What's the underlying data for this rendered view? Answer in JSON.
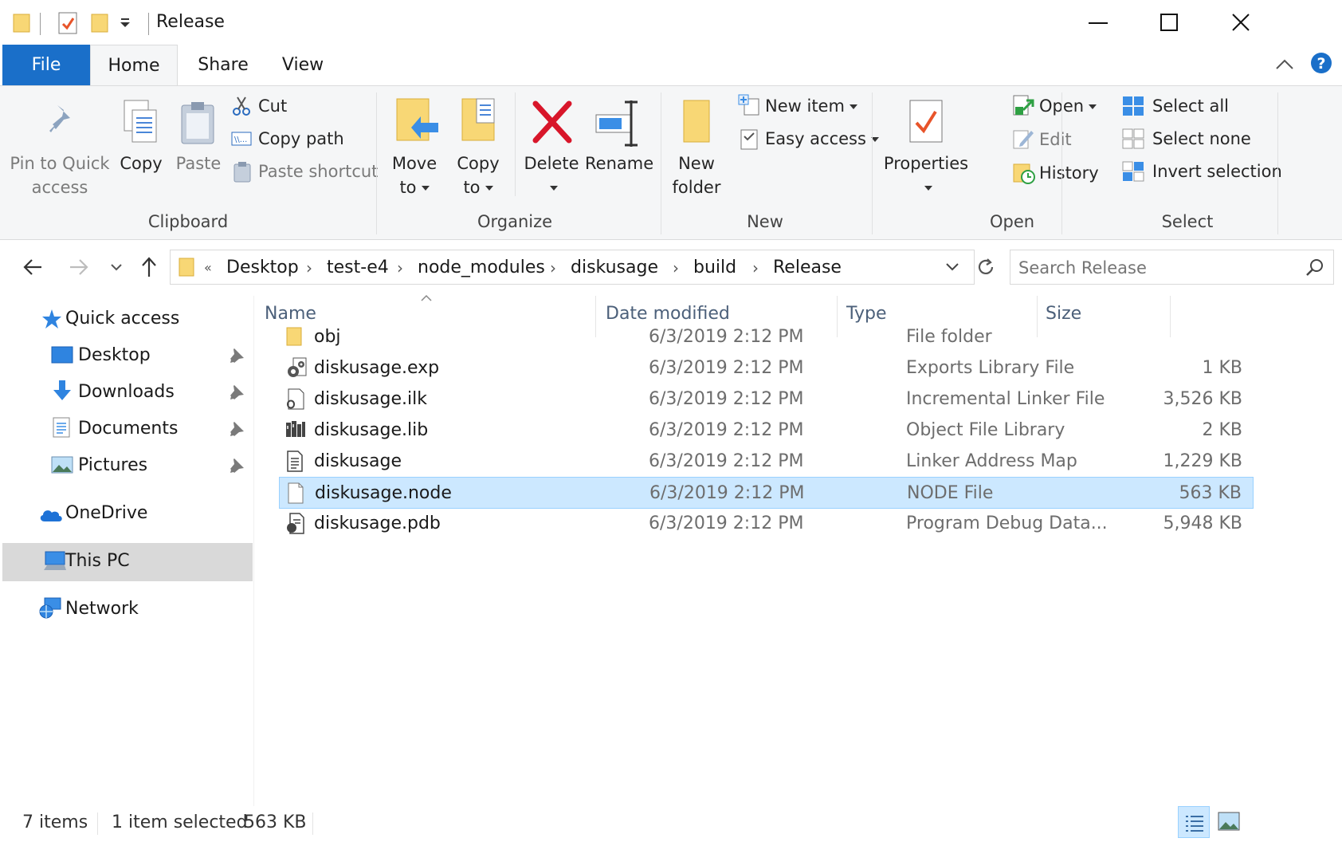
{
  "window": {
    "title": "Release",
    "controls": {
      "minimize": "minimize-icon",
      "maximize": "maximize-icon",
      "close": "close-icon"
    }
  },
  "ribbon_tabs": [
    {
      "label": "File",
      "active": false
    },
    {
      "label": "Home",
      "active": true
    },
    {
      "label": "Share",
      "active": false
    },
    {
      "label": "View",
      "active": false
    }
  ],
  "ribbon": {
    "clipboard": {
      "label": "Clipboard",
      "pin_line1": "Pin to Quick",
      "pin_line2": "access",
      "copy": "Copy",
      "paste": "Paste",
      "cut": "Cut",
      "copy_path": "Copy path",
      "paste_shortcut": "Paste shortcut"
    },
    "organize": {
      "label": "Organize",
      "move_line1": "Move",
      "move_line2": "to",
      "copy_line1": "Copy",
      "copy_line2": "to",
      "delete": "Delete",
      "rename": "Rename"
    },
    "new": {
      "label": "New",
      "new_folder_line1": "New",
      "new_folder_line2": "folder",
      "new_item": "New item",
      "easy_access": "Easy access"
    },
    "open": {
      "label": "Open",
      "properties": "Properties",
      "open": "Open",
      "edit": "Edit",
      "history": "History"
    },
    "select": {
      "label": "Select",
      "select_all": "Select all",
      "select_none": "Select none",
      "invert_selection": "Invert selection"
    }
  },
  "address": {
    "overflow": "«",
    "crumbs": [
      "Desktop",
      "test-e4",
      "node_modules",
      "diskusage",
      "build",
      "Release"
    ],
    "search_placeholder": "Search Release"
  },
  "nav": {
    "quick_access": "Quick access",
    "pinned": [
      "Desktop",
      "Downloads",
      "Documents",
      "Pictures"
    ],
    "onedrive": "OneDrive",
    "this_pc": "This PC",
    "network": "Network"
  },
  "columns": {
    "name": "Name",
    "date": "Date modified",
    "type": "Type",
    "size": "Size"
  },
  "files": [
    {
      "name": "obj",
      "date": "6/3/2019 2:12 PM",
      "type": "File folder",
      "size": "",
      "icon": "folder-icon"
    },
    {
      "name": "diskusage.exp",
      "date": "6/3/2019 2:12 PM",
      "type": "Exports Library File",
      "size": "1 KB",
      "icon": "gear-file-icon"
    },
    {
      "name": "diskusage.ilk",
      "date": "6/3/2019 2:12 PM",
      "type": "Incremental Linker File",
      "size": "3,526 KB",
      "icon": "linker-file-icon"
    },
    {
      "name": "diskusage.lib",
      "date": "6/3/2019 2:12 PM",
      "type": "Object File Library",
      "size": "2 KB",
      "icon": "library-file-icon"
    },
    {
      "name": "diskusage",
      "date": "6/3/2019 2:12 PM",
      "type": "Linker Address Map",
      "size": "1,229 KB",
      "icon": "text-file-icon"
    },
    {
      "name": "diskusage.node",
      "date": "6/3/2019 2:12 PM",
      "type": "NODE File",
      "size": "563 KB",
      "icon": "blank-file-icon",
      "selected": true
    },
    {
      "name": "diskusage.pdb",
      "date": "6/3/2019 2:12 PM",
      "type": "Program Debug Data...",
      "size": "5,948 KB",
      "icon": "debug-file-icon"
    }
  ],
  "status": {
    "count": "7 items",
    "selected": "1 item selected",
    "selected_size": "563 KB"
  },
  "colors": {
    "accent": "#1a6fc9",
    "selection": "#cce8ff",
    "selection_border": "#99d1ff",
    "folder": "#f8d775"
  }
}
